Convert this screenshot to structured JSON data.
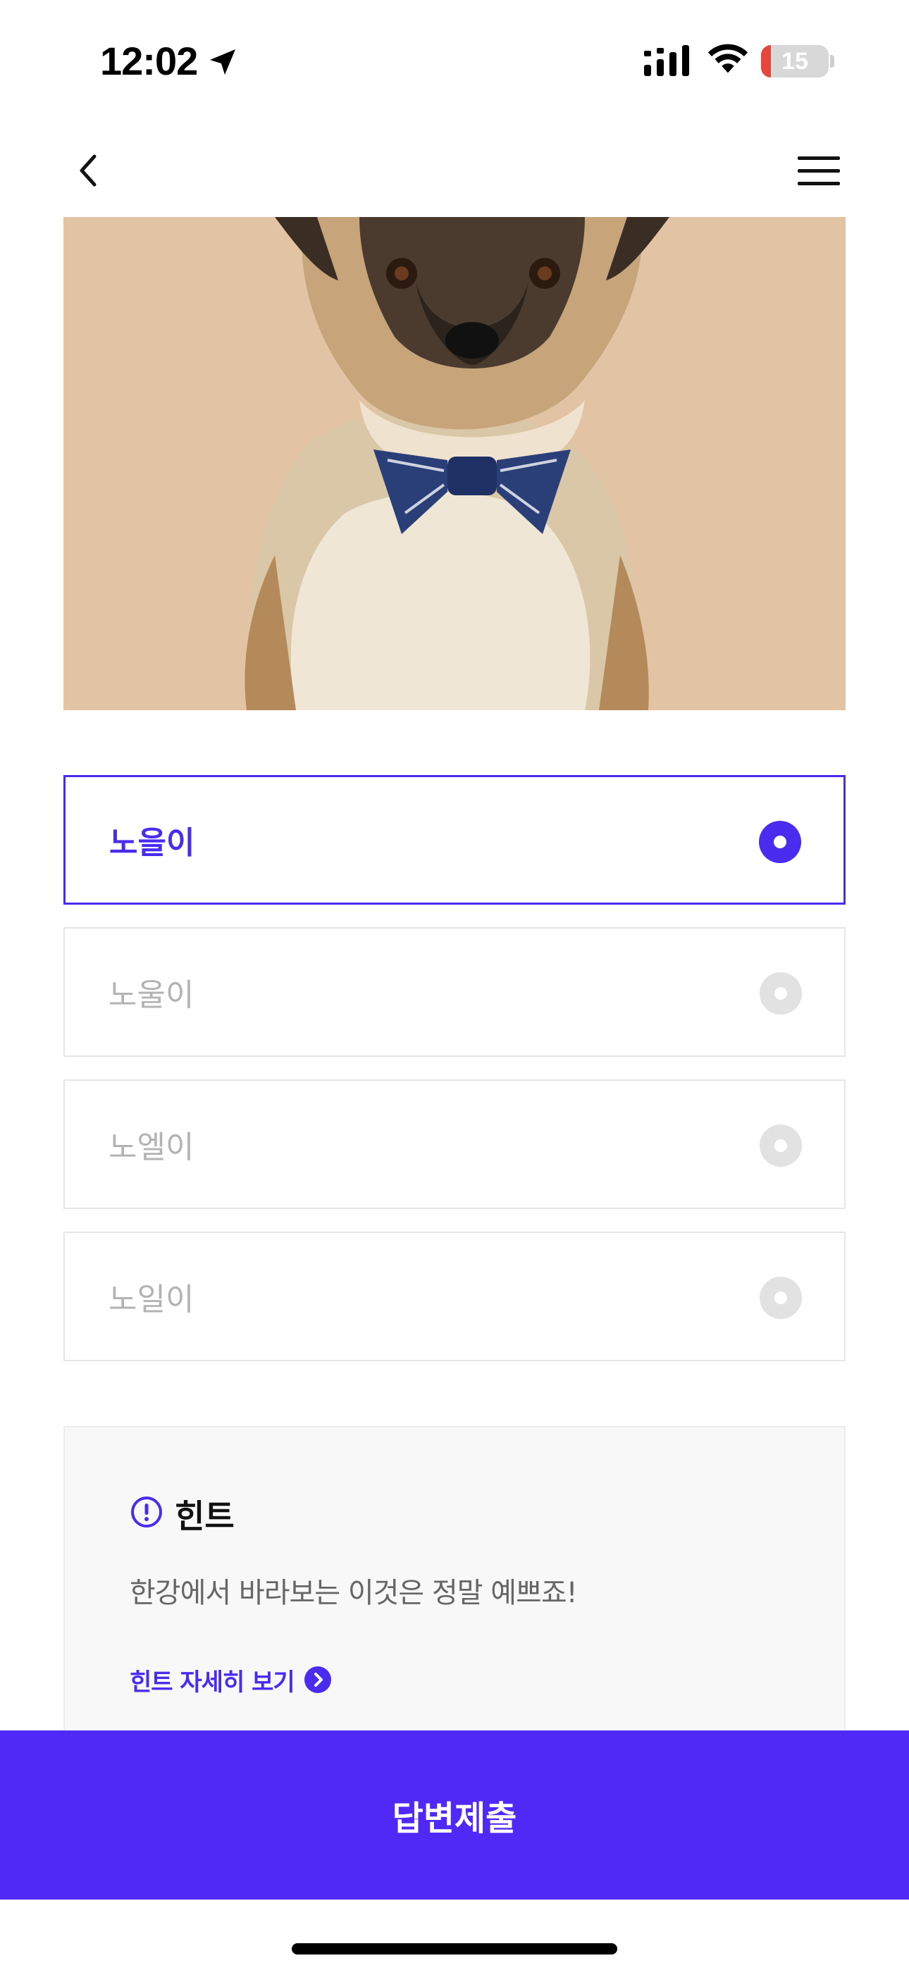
{
  "status_bar": {
    "time": "12:02",
    "battery_level": "15",
    "icons": [
      "location-arrow-icon",
      "cellular-signal-icon",
      "wifi-icon",
      "battery-icon"
    ]
  },
  "nav": {
    "back_icon": "chevron-left-icon",
    "menu_icon": "hamburger-menu-icon"
  },
  "hero": {
    "image": "dog-with-bow-tie-photo",
    "background_color": "#e2c3a3"
  },
  "options": [
    {
      "label": "노을이",
      "selected": true
    },
    {
      "label": "노울이",
      "selected": false
    },
    {
      "label": "노엘이",
      "selected": false
    },
    {
      "label": "노일이",
      "selected": false
    }
  ],
  "hint": {
    "icon": "exclamation-circle-icon",
    "title": "힌트",
    "text": "한강에서 바라보는 이것은 정말 예쁘죠!",
    "link_label": "힌트 자세히 보기",
    "link_icon": "chevron-right-circle-icon"
  },
  "submit": {
    "label": "답변제출"
  },
  "colors": {
    "accent": "#4a2bf0",
    "submit_bg": "#5029f6",
    "option_inactive": "#b3b3b3",
    "battery_low": "#e8453c"
  }
}
